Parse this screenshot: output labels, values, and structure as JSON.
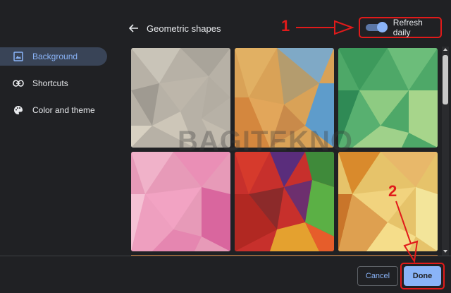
{
  "sidebar": {
    "items": [
      {
        "label": "Background",
        "icon": "image-icon",
        "active": true
      },
      {
        "label": "Shortcuts",
        "icon": "link-icon",
        "active": false
      },
      {
        "label": "Color and theme",
        "icon": "palette-icon",
        "active": false
      }
    ]
  },
  "header": {
    "title": "Geometric shapes",
    "back_icon": "arrow-left-icon"
  },
  "refresh": {
    "label": "Refresh daily",
    "enabled": true
  },
  "annotations": {
    "step1": "1",
    "step2": "2"
  },
  "watermark": "BAGITEKNO",
  "footer": {
    "cancel_label": "Cancel",
    "done_label": "Done"
  },
  "colors": {
    "accent": "#8ab4f8",
    "background": "#202124",
    "active_nav": "#394457",
    "annotation_red": "#e11a1a"
  }
}
